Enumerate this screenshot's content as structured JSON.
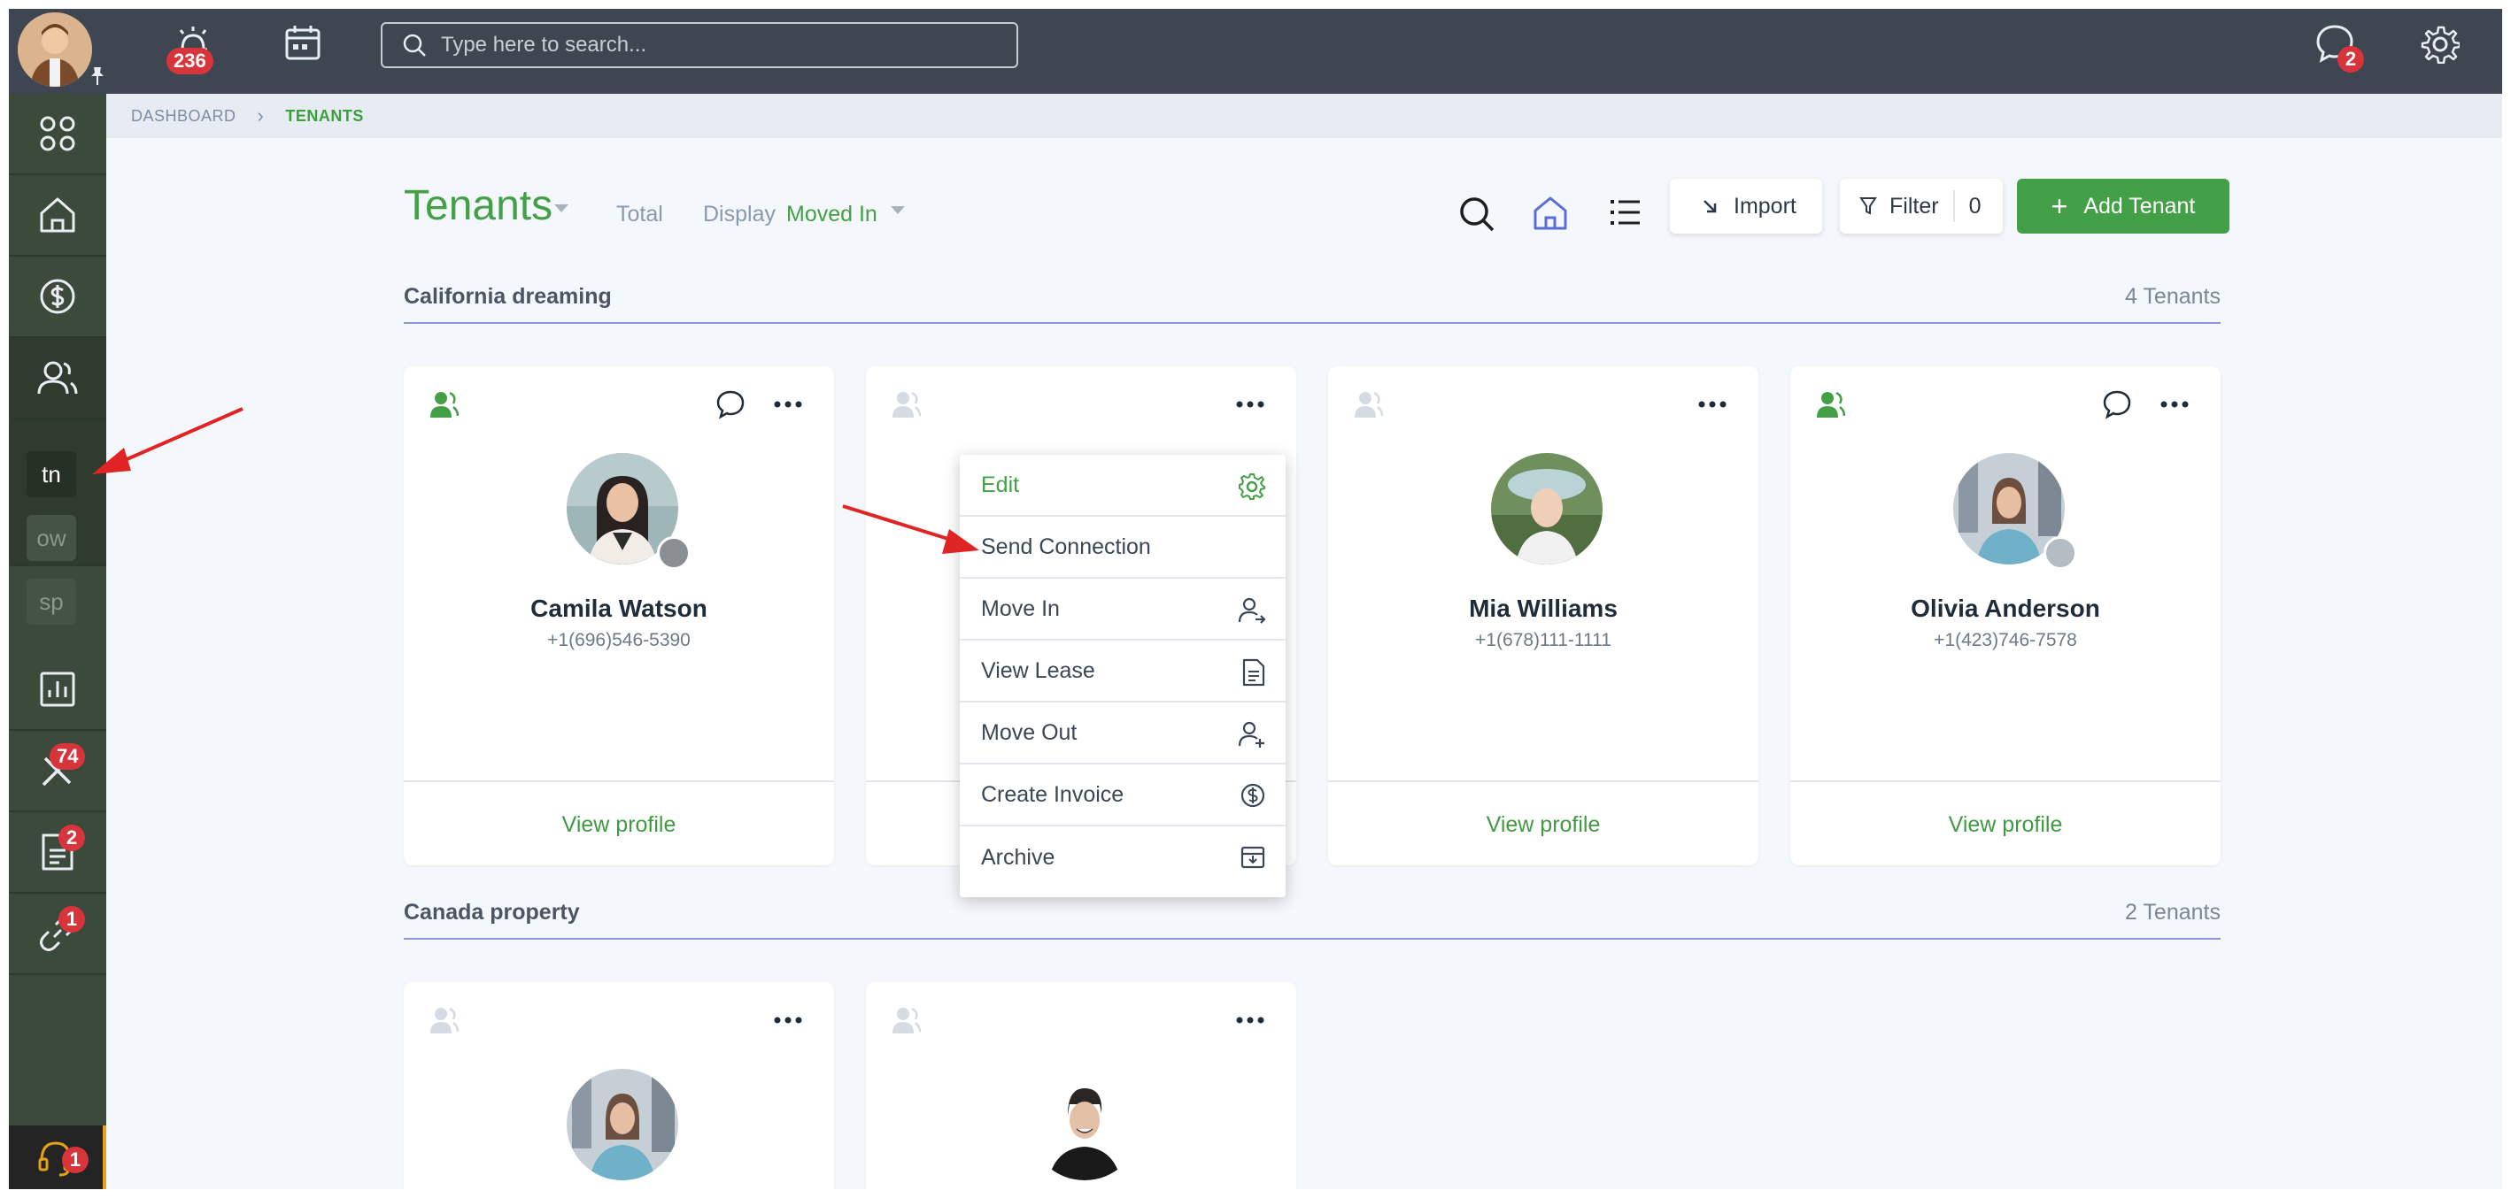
{
  "topbar": {
    "notifications_count": "236",
    "search_placeholder": "Type here to search...",
    "messages_count": "2"
  },
  "sidebar": {
    "sub_items": [
      "tn",
      "ow",
      "sp"
    ],
    "maintenance_badge": "74",
    "documents_badge": "2",
    "connections_badge": "1",
    "support_badge": "1"
  },
  "breadcrumb": {
    "root": "DASHBOARD",
    "current": "TENANTS"
  },
  "header": {
    "title": "Tenants",
    "total_label": "Total",
    "display_label": "Display",
    "display_value": "Moved In",
    "import_label": "Import",
    "filter_label": "Filter",
    "filter_count": "0",
    "add_label": "Add Tenant"
  },
  "groups": [
    {
      "title": "California dreaming",
      "count": "4 Tenants",
      "cards": [
        {
          "name": "Camila Watson",
          "phone": "+1(696)546-5390",
          "view": "View profile"
        },
        {
          "name": "",
          "phone": "",
          "view": ""
        },
        {
          "name": "Mia Williams",
          "phone": "+1(678)111-1111",
          "view": "View profile"
        },
        {
          "name": "Olivia Anderson",
          "phone": "+1(423)746-7578",
          "view": "View profile"
        }
      ]
    },
    {
      "title": "Canada property",
      "count": "2 Tenants"
    }
  ],
  "menu": {
    "items": [
      "Edit",
      "Send Connection",
      "Move In",
      "View Lease",
      "Move Out",
      "Create Invoice",
      "Archive"
    ]
  },
  "colors": {
    "accent_green": "#43a047",
    "topbar": "#3d4651",
    "sidebar": "#3b4a3a",
    "badge_red": "#d8343c",
    "annotation_red": "#e02424"
  }
}
